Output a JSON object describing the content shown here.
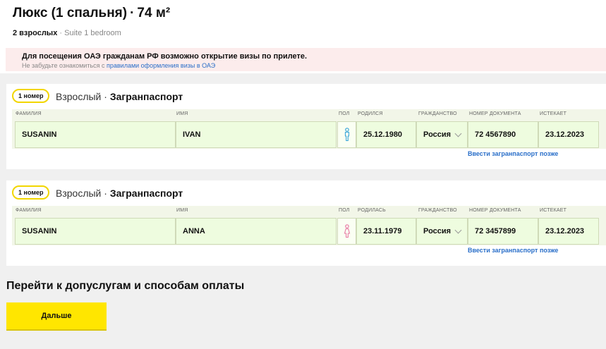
{
  "room": {
    "title": "Люкс (1 спальня)",
    "area": "74 м²",
    "guests": "2 взрослых",
    "subtitle": "Suite 1 bedroom"
  },
  "visa_banner": {
    "text": "Для посещения ОАЭ гражданам РФ возможно открытие визы по прилете.",
    "note_prefix": "Не забудьте ознакомиться с ",
    "link_text": "правилами оформления визы в ОАЭ"
  },
  "form_labels": {
    "surname": "фамилия",
    "name": "имя",
    "gender": "пол",
    "citizenship": "гражданство",
    "doc_number": "номер документа",
    "expires": "истекает"
  },
  "guests": [
    {
      "room_badge": "1 номер",
      "type": "Взрослый",
      "document": "Загранпаспорт",
      "born_label": "родился",
      "surname": "SUSANIN",
      "name": "IVAN",
      "gender_icon": "male-icon",
      "birth_date": "25.12.1980",
      "citizenship": "Россия",
      "doc_number": "72 4567890",
      "expires": "23.12.2023",
      "later_link": "Ввести загранпаспорт позже"
    },
    {
      "room_badge": "1 номер",
      "type": "Взрослый",
      "document": "Загранпаспорт",
      "born_label": "родилась",
      "surname": "SUSANIN",
      "name": "ANNA",
      "gender_icon": "female-icon",
      "birth_date": "23.11.1979",
      "citizenship": "Россия",
      "doc_number": "72 3457899",
      "expires": "23.12.2023",
      "later_link": "Ввести загранпаспорт позже"
    }
  ],
  "next_section": {
    "heading": "Перейти к допуслугам и способам оплаты",
    "button": "Дальше"
  },
  "colors": {
    "accent_yellow": "#ffe600",
    "link_blue": "#2a6fc9",
    "male_icon": "#3aa6d8",
    "female_icon": "#e87aa4",
    "banner_pink": "#fcecec",
    "field_green": "#eefcdf"
  }
}
